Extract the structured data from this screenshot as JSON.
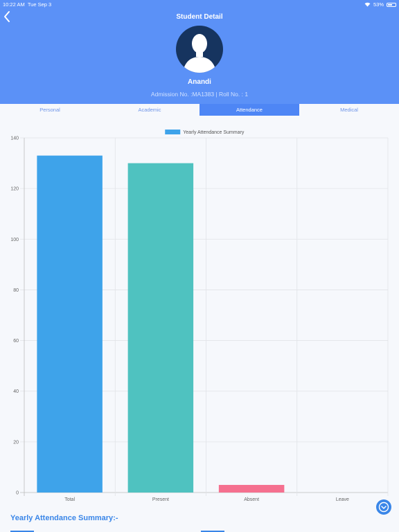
{
  "status_bar": {
    "time": "10:22 AM",
    "date": "Tue Sep 3",
    "battery": "53%"
  },
  "header": {
    "title": "Student Detail",
    "name": "Anandi",
    "subtitle": "Admission No. :MA1383 | Roll No. : 1"
  },
  "tabs": [
    {
      "label": "Personal",
      "active": false
    },
    {
      "label": "Academic",
      "active": false
    },
    {
      "label": "Attendance",
      "active": true
    },
    {
      "label": "Medical",
      "active": false
    }
  ],
  "chart_data": {
    "type": "bar",
    "legend": "Yearly Attendance Summary",
    "categories": [
      "Total",
      "Present",
      "Absent",
      "Leave"
    ],
    "values": [
      133,
      130,
      3,
      0
    ],
    "colors": [
      "#3ea3ea",
      "#4fc2c0",
      "#f5708f",
      "#c9cbcf"
    ],
    "ylim": [
      0,
      140
    ],
    "yticks": [
      0,
      20,
      40,
      60,
      80,
      100,
      120,
      140
    ],
    "grid": true
  },
  "summary": {
    "title": "Yearly Attendance Summary:-"
  },
  "colors": {
    "header": "#5b91f7",
    "accent": "#3a86e8"
  }
}
